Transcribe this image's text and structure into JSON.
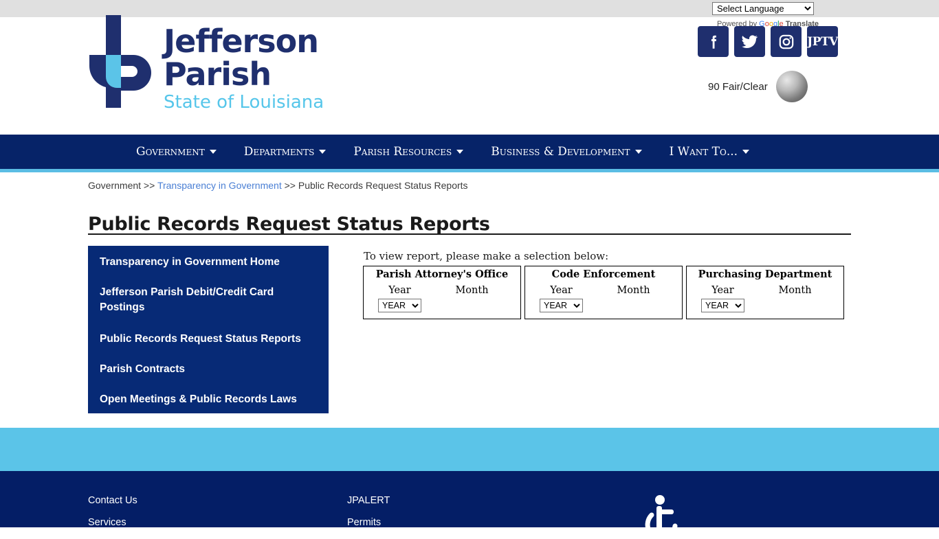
{
  "topbar": {
    "language_select": {
      "value": "Select Language",
      "options": [
        "Select Language"
      ]
    },
    "powered_by": {
      "prefix": "Powered by",
      "brand": "Google",
      "suffix": "Translate"
    }
  },
  "logo": {
    "line1": "Jefferson",
    "line2": "Parish",
    "line3": "State of Louisiana",
    "mark_alt": "jp-monogram",
    "navy": "#1f2f6e",
    "cyan": "#56c6ea"
  },
  "social": [
    {
      "name": "facebook-icon",
      "label": "Facebook"
    },
    {
      "name": "twitter-icon",
      "label": "Twitter"
    },
    {
      "name": "instagram-icon",
      "label": "Instagram"
    },
    {
      "name": "jptv-icon",
      "label": "JPTV"
    }
  ],
  "weather": {
    "text": "90 Fair/Clear"
  },
  "nav": {
    "items": [
      {
        "label": "Government",
        "has_caret": true
      },
      {
        "label": "Departments",
        "has_caret": true
      },
      {
        "label": "Parish Resources",
        "has_caret": true
      },
      {
        "label": "Business & Development",
        "has_caret": true
      },
      {
        "label": "I Want To...",
        "has_caret": true
      }
    ],
    "bg": "#062368",
    "underline": "#5bbde4"
  },
  "breadcrumb": {
    "root": "Government",
    "sep1": " >> ",
    "link": "Transparency in Government",
    "sep2": " >> ",
    "current": "Public Records Request Status Reports"
  },
  "page": {
    "title": "Public Records Request Status Reports"
  },
  "sidebar": {
    "items": [
      {
        "label": "Transparency in Government Home"
      },
      {
        "label": "Jefferson Parish Debit/Credit Card Postings"
      },
      {
        "label": "Public Records Request Status Reports"
      },
      {
        "label": "Parish Contracts"
      },
      {
        "label": "Open Meetings & Public Records Laws"
      }
    ],
    "bg": "#072a76"
  },
  "main": {
    "intro": "To view report, please make a selection below:",
    "cards": [
      {
        "title": "Parish Attorney's Office",
        "year_label": "Year",
        "month_label": "Month",
        "year_value": "YEAR",
        "year_options": [
          "YEAR"
        ]
      },
      {
        "title": "Code Enforcement",
        "year_label": "Year",
        "month_label": "Month",
        "year_value": "YEAR",
        "year_options": [
          "YEAR"
        ]
      },
      {
        "title": "Purchasing Department",
        "year_label": "Year",
        "month_label": "Month",
        "year_value": "YEAR",
        "year_options": [
          "YEAR"
        ]
      }
    ]
  },
  "footer": {
    "band_color": "#5bc4e8",
    "bg": "#041e66",
    "column1": [
      {
        "label": "Contact Us"
      },
      {
        "label": "Services"
      }
    ],
    "column2": [
      {
        "label": "JPALERT"
      },
      {
        "label": "Permits"
      }
    ],
    "accessibility_icon": "wheelchair-accessibility-icon"
  }
}
